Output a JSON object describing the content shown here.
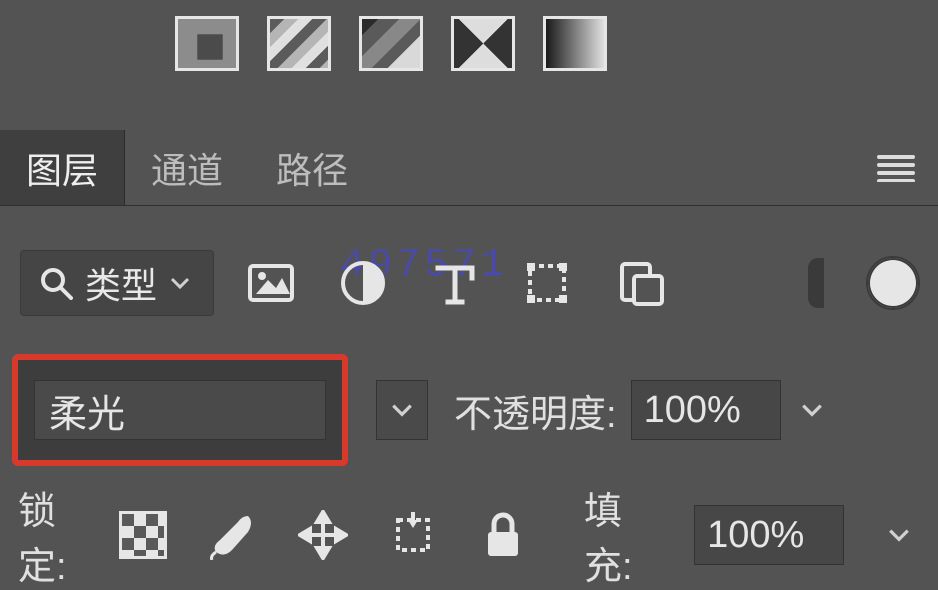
{
  "swatches": [
    "solid",
    "stripes",
    "jagged",
    "angle",
    "gradient"
  ],
  "tabs": [
    "图层",
    "通道",
    "路径"
  ],
  "active_tab": 0,
  "filter": {
    "kind_label": "类型"
  },
  "watermark": "497571",
  "blend": {
    "mode": "柔光",
    "opacity_label": "不透明度:",
    "opacity_value": "100%"
  },
  "lock": {
    "label": "锁定:",
    "fill_label": "填充:",
    "fill_value": "100%"
  }
}
